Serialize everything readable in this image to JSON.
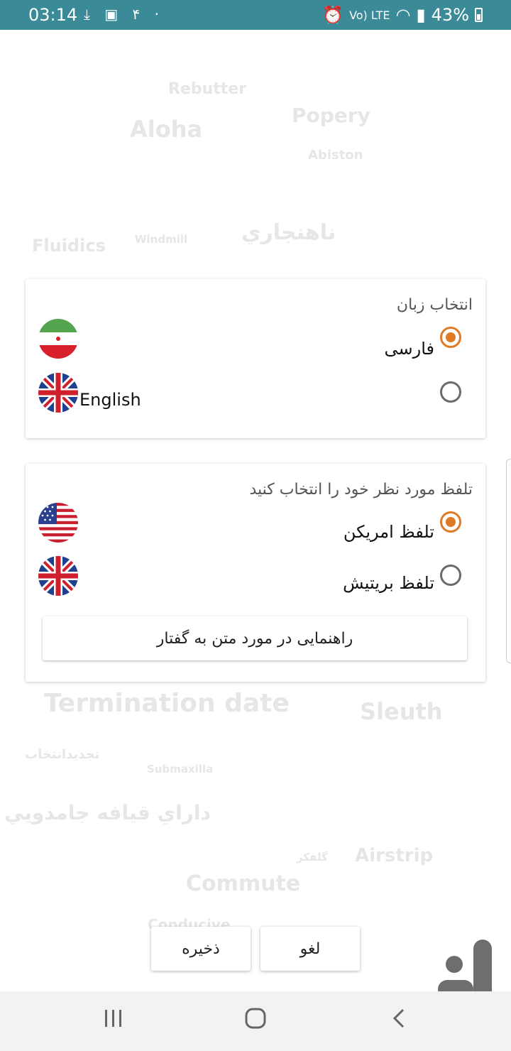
{
  "status_bar": {
    "time": "03:14",
    "left_extra": "۴",
    "network": "Vo) LTE",
    "battery": "43%"
  },
  "background_words": [
    {
      "text": "Rebutter"
    },
    {
      "text": "Popery"
    },
    {
      "text": "Aloha"
    },
    {
      "text": "Abiston"
    },
    {
      "text": "ناهنجاري"
    },
    {
      "text": "Fluidics"
    },
    {
      "text": "Windmill"
    },
    {
      "text": "Termination date"
    },
    {
      "text": "Sleuth"
    },
    {
      "text": "تجديدانتخاب"
    },
    {
      "text": "Submaxilla"
    },
    {
      "text": "داراي قيافه جامدويي"
    },
    {
      "text": "Airstrip"
    },
    {
      "text": "گلفكر"
    },
    {
      "text": "Commute"
    },
    {
      "text": "Conducive"
    }
  ],
  "language_card": {
    "title": "انتخاب زبان",
    "options": [
      {
        "label": "فارسی",
        "selected": true,
        "flag": "iran-flag"
      },
      {
        "label": "English",
        "selected": false,
        "flag": "uk-flag"
      }
    ]
  },
  "accent_card": {
    "title": "تلفظ مورد نظر خود را انتخاب کنید",
    "options": [
      {
        "label": "تلفظ امریکن",
        "selected": true,
        "flag": "us-flag"
      },
      {
        "label": "تلفظ بریتیش",
        "selected": false,
        "flag": "uk-flag"
      }
    ],
    "guide_button": "راهنمایی در مورد متن به گفتار"
  },
  "actions": {
    "save": "ذخیره",
    "cancel": "لغو"
  },
  "colors": {
    "status_bar": "#3a8a98",
    "radio_selected": "#e07b25",
    "radio_unselected": "#6b6b6b"
  }
}
